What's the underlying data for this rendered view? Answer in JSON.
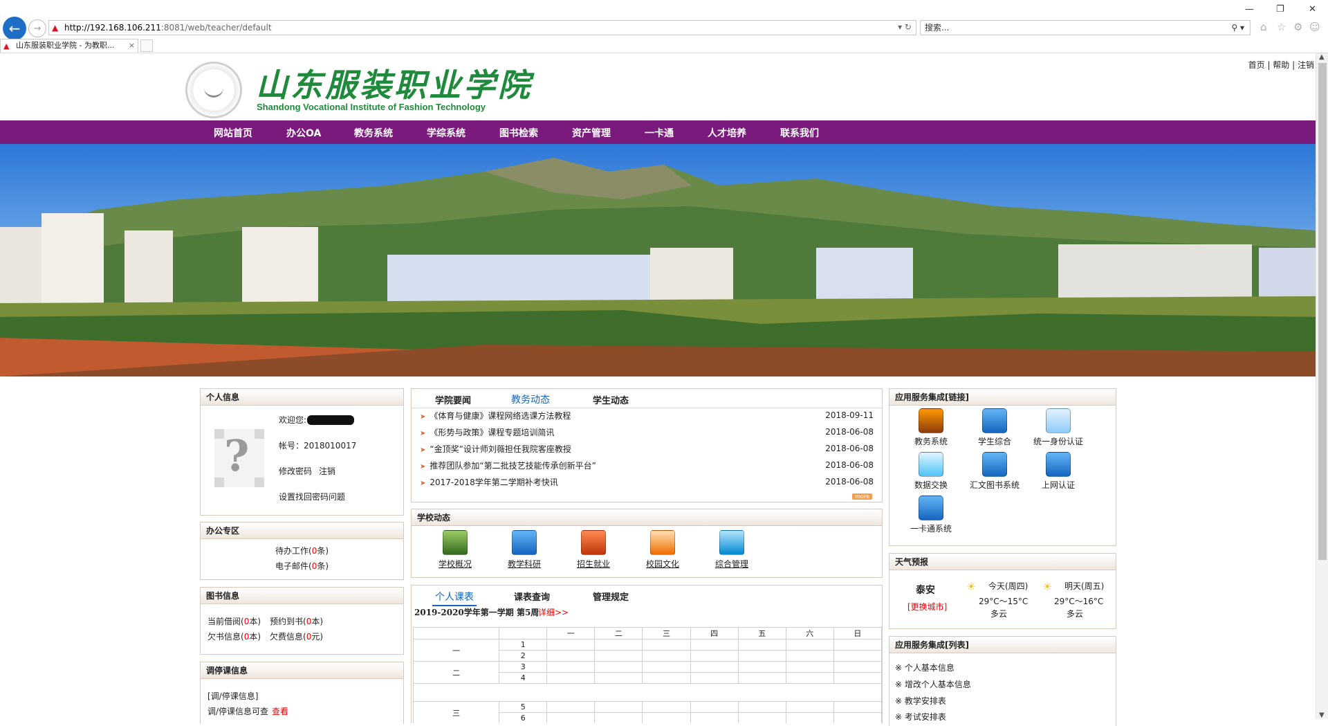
{
  "browser": {
    "url_host": "http://192.168.106.211",
    "url_rest": ":8081/web/teacher/default",
    "search_placeholder": "搜索...",
    "tab_title": "山东服装职业学院 - 为教职..."
  },
  "header": {
    "logo_cn": "山东服装职业学院",
    "logo_en": "Shandong Vocational Institute of Fashion Technology",
    "links": [
      "首页",
      "帮助",
      "注销"
    ]
  },
  "nav": [
    "网站首页",
    "办公OA",
    "教务系统",
    "学综系统",
    "图书检索",
    "资产管理",
    "一卡通",
    "人才培养",
    "联系我们"
  ],
  "personal": {
    "title": "个人信息",
    "welcome": "欢迎您:",
    "account": "帐号：2018010017",
    "change_pwd": "修改密码",
    "logout": "注销",
    "security": "设置找回密码问题"
  },
  "office": {
    "title": "办公专区",
    "todo_prefix": "待办工作(",
    "todo_count": "0",
    "todo_suffix": "条)",
    "mail_prefix": "电子邮件(",
    "mail_count": "0",
    "mail_suffix": "条)"
  },
  "library": {
    "title": "图书信息",
    "borrow_prefix": "当前借阅(",
    "borrow_count": "0",
    "borrow_suffix": "本)",
    "reserve_prefix": "预约到书(",
    "reserve_count": "0",
    "reserve_suffix": "本)",
    "overdue_prefix": "欠书信息(",
    "overdue_count": "0",
    "overdue_suffix": "本)",
    "fine_prefix": "欠费信息(",
    "fine_count": "0",
    "fine_suffix": "元)"
  },
  "schedule_change": {
    "title": "调停课信息",
    "line1": "[调/停课信息]",
    "line2": "调/停课信息可查",
    "view": "查看"
  },
  "news": {
    "tabs": [
      "学院要闻",
      "教务动态",
      "学生动态"
    ],
    "items": [
      {
        "title": "《体育与健康》课程网络选课方法教程",
        "date": "2018-09-11"
      },
      {
        "title": "《形势与政策》课程专题培训简讯",
        "date": "2018-06-08"
      },
      {
        "title": "“金顶奖”设计师刘薇担任我院客座教授",
        "date": "2018-06-08"
      },
      {
        "title": "推荐团队参加“第二批技艺技能传承创新平台”",
        "date": "2018-06-08"
      },
      {
        "title": "2017-2018学年第二学期补考快讯",
        "date": "2018-06-08"
      }
    ],
    "more": "more"
  },
  "school": {
    "title": "学校动态",
    "tiles": [
      "学校概况",
      "教学科研",
      "招生就业",
      "校园文化",
      "综合管理"
    ]
  },
  "timetable": {
    "tabs": [
      "个人课表",
      "课表查询",
      "管理规定"
    ],
    "term": "2019-2020学年第一学期 第5周",
    "detail": "详细>>",
    "days": [
      "一",
      "二",
      "三",
      "四",
      "五",
      "六",
      "日"
    ],
    "groups": [
      "一",
      "二",
      "三"
    ],
    "periods": [
      "1",
      "2",
      "3",
      "4",
      "5",
      "6"
    ]
  },
  "apps": {
    "title": "应用服务集成[链接]",
    "items": [
      "教务系统",
      "学生综合",
      "统一身份认证",
      "数据交换",
      "汇文图书系统",
      "上网认证",
      "一卡通系统"
    ]
  },
  "weather": {
    "title": "天气预报",
    "city": "泰安",
    "change": "[更换城市]",
    "today_label": "今天(周四)",
    "today_temp": "29°C～15°C",
    "today_desc": "多云",
    "tomorrow_label": "明天(周五)",
    "tomorrow_temp": "29°C～16°C",
    "tomorrow_desc": "多云"
  },
  "service_list": {
    "title": "应用服务集成[列表]",
    "items": [
      "个人基本信息",
      "增改个人基本信息",
      "教学安排表",
      "考试安排表"
    ]
  },
  "colors": {
    "nav_bg": "#7a1a7c",
    "logo_green": "#1f8a3b"
  }
}
